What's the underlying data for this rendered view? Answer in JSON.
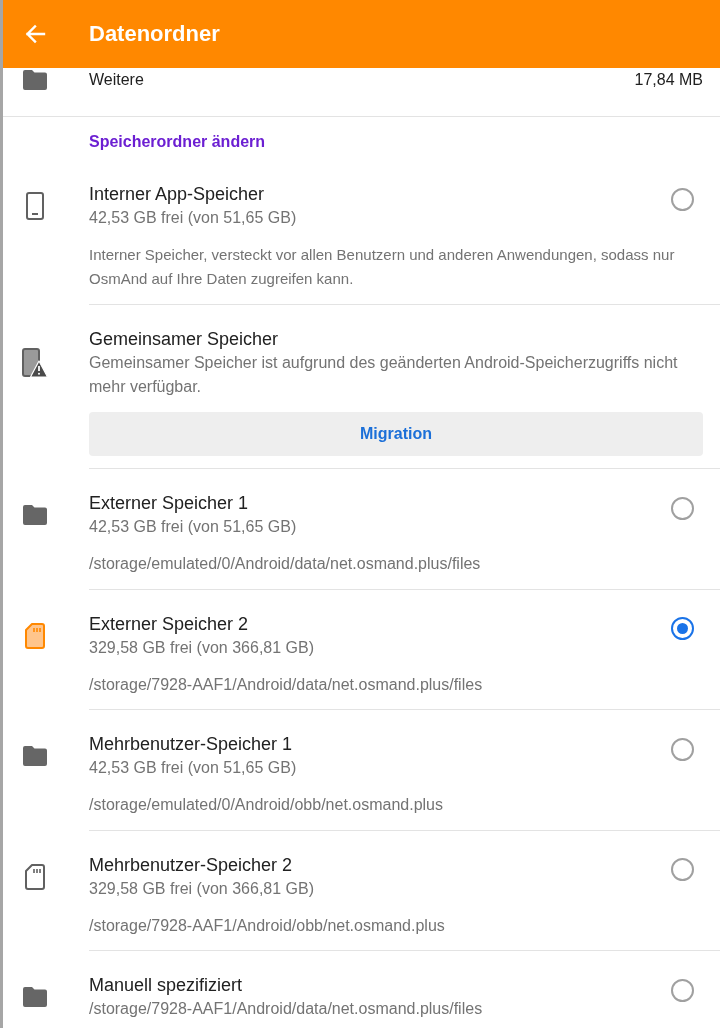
{
  "app_bar": {
    "title": "Datenordner"
  },
  "data_rows": [
    {
      "label": "Weitere",
      "size": "17,84 MB"
    }
  ],
  "section": {
    "title": "Speicherordner ändern"
  },
  "storage_options": [
    {
      "kind": "device",
      "title": "Interner App-Speicher",
      "subtitle": "42,53 GB frei (von 51,65 GB)",
      "description": "Interner Speicher, versteckt vor allen Benutzern und anderen Anwendungen, sodass nur OsmAnd auf Ihre Daten zugreifen kann.",
      "selected": false
    },
    {
      "kind": "device_warning",
      "title": "Gemeinsamer Speicher",
      "subtitle": "Gemeinsamer Speicher ist aufgrund des geänderten Android-Speicherzugriffs nicht mehr verfügbar.",
      "button": "Migration"
    },
    {
      "kind": "folder",
      "title": "Externer Speicher 1",
      "subtitle": "42,53 GB frei (von 51,65 GB)",
      "path": "/storage/emulated/0/Android/data/net.osmand.plus/files",
      "selected": false
    },
    {
      "kind": "card",
      "title": "Externer Speicher 2",
      "subtitle": "329,58 GB frei (von 366,81 GB)",
      "path": "/storage/7928-AAF1/Android/data/net.osmand.plus/files",
      "selected": true
    },
    {
      "kind": "folder",
      "title": "Mehrbenutzer-Speicher 1",
      "subtitle": "42,53 GB frei (von 51,65 GB)",
      "path": "/storage/emulated/0/Android/obb/net.osmand.plus",
      "selected": false
    },
    {
      "kind": "card",
      "title": "Mehrbenutzer-Speicher 2",
      "subtitle": "329,58 GB frei (von 366,81 GB)",
      "path": "/storage/7928-AAF1/Android/obb/net.osmand.plus",
      "selected": false
    },
    {
      "kind": "folder",
      "title": "Manuell spezifiziert",
      "subtitle": "/storage/7928-AAF1/Android/data/net.osmand.plus/files",
      "selected": false
    }
  ]
}
